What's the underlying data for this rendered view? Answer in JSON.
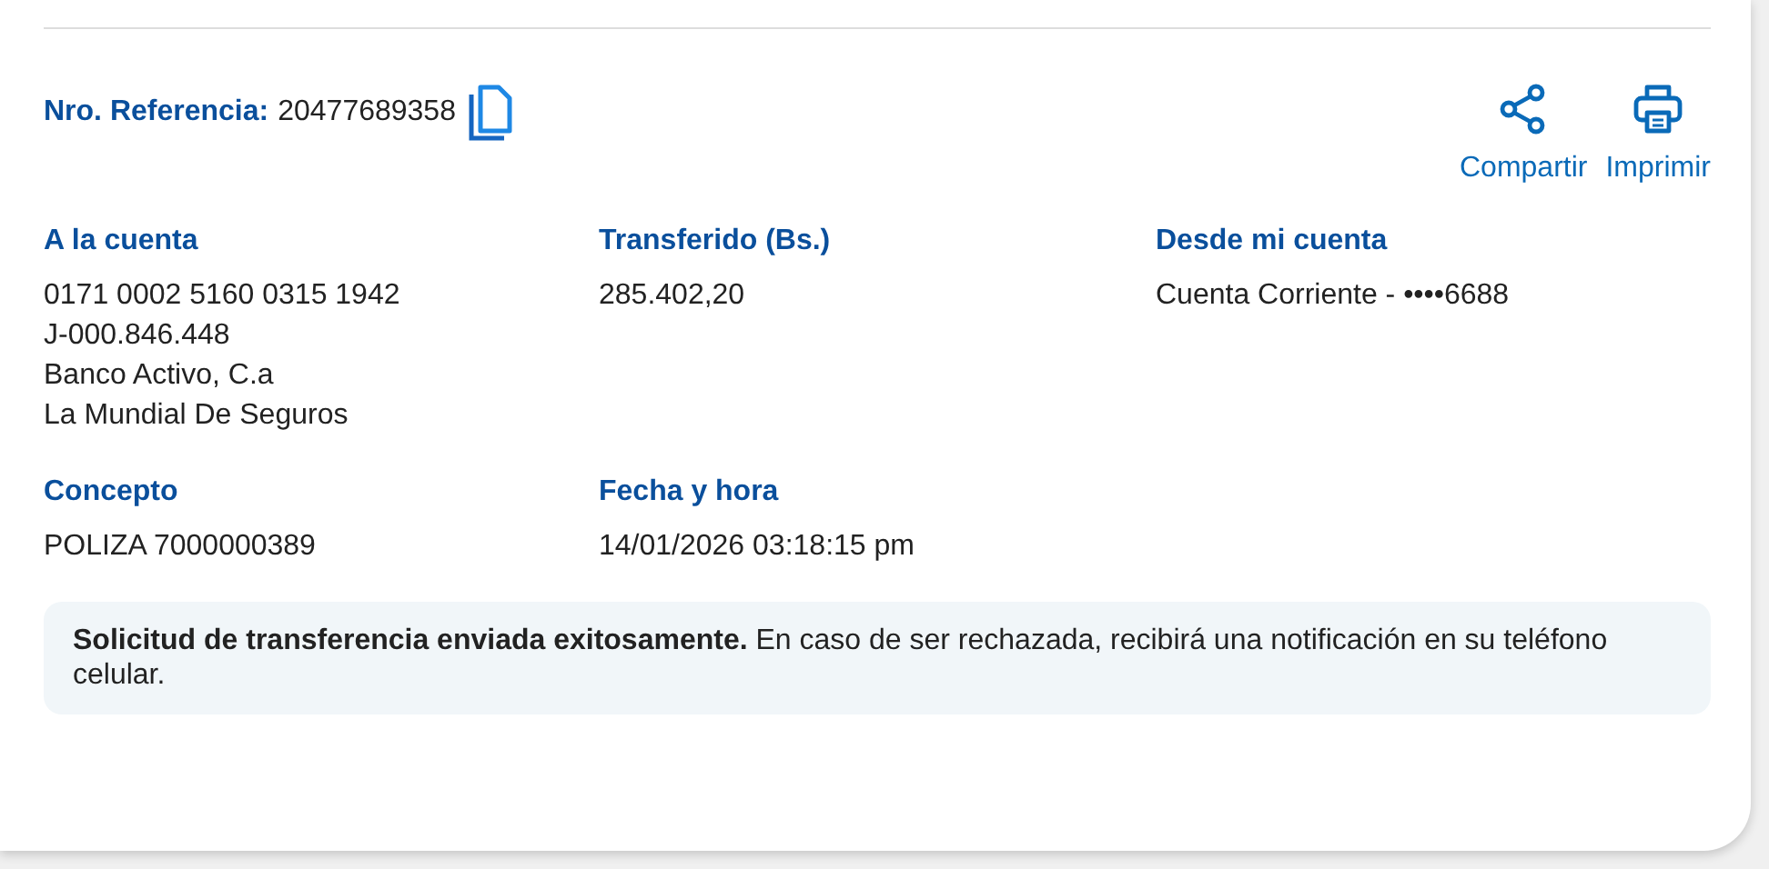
{
  "reference": {
    "label": "Nro. Referencia:",
    "value": "20477689358"
  },
  "actions": [
    {
      "kind": "share",
      "label": "Compartir"
    },
    {
      "kind": "print",
      "label": "Imprimir"
    }
  ],
  "fields": [
    {
      "label": "A la cuenta",
      "lines": [
        "0171 0002 5160 0315 1942",
        "J-000.846.448",
        "Banco Activo, C.a",
        "La Mundial De Seguros"
      ]
    },
    {
      "label": "Transferido (Bs.)",
      "lines": [
        "285.402,20"
      ]
    },
    {
      "label": "Desde mi cuenta",
      "lines": [
        "Cuenta Corriente - ••••6688"
      ]
    },
    {
      "label": "Concepto",
      "lines": [
        "POLIZA 7000000389"
      ]
    },
    {
      "label": "Fecha y hora",
      "lines": [
        "14/01/2026 03:18:15 pm"
      ]
    }
  ],
  "notice": "**Solicitud de transferencia enviada exitosamente.** En caso de ser rechazada, recibirá una notificación en su teléfono celular."
}
